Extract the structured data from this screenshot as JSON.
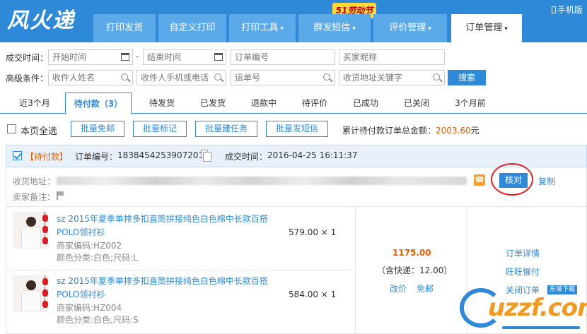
{
  "colors": {
    "brand": "#2e8ad8",
    "accent": "#e55c00",
    "highlight": "#e02020"
  },
  "header": {
    "logo": "风火递",
    "promo": "51劳动节",
    "mobile": "手机版",
    "nav": [
      {
        "label": "打印发货",
        "caret": ""
      },
      {
        "label": "自定义打印",
        "caret": ""
      },
      {
        "label": "打印工具",
        "caret": "▾"
      },
      {
        "label": "群发短信",
        "caret": "▾"
      },
      {
        "label": "评价管理",
        "caret": "▾"
      },
      {
        "label": "订单管理",
        "caret": "▾"
      }
    ]
  },
  "search": {
    "deal_time_label": "成交时间：",
    "advanced_label": "高级条件：",
    "start_time": "开始时间",
    "end_time": "结束时间",
    "order_no": "订单编号",
    "buyer_nick": "买家昵称",
    "receiver_name": "收件人姓名",
    "receiver_phone": "收件人手机或电话",
    "tracking_no": "运单号",
    "address_keyword": "收货地址关键字",
    "button": "搜索"
  },
  "status_tabs": [
    "近3个月",
    "待付款（3）",
    "待发货",
    "已发货",
    "退款中",
    "待评价",
    "已成功",
    "已关闭",
    "3个月前"
  ],
  "bulk": {
    "select_all": "本页全选",
    "buttons": [
      "批量免邮",
      "批量标记",
      "批量建任务",
      "批量发短信"
    ],
    "total_label": "累计待付款订单总金额：",
    "total_amount": "2003.60",
    "total_unit": "元"
  },
  "order": {
    "status_tag": "【待付款】",
    "order_no_label": "订单编号：",
    "order_no": "1838454253907201",
    "deal_time_label": "成交时间：",
    "deal_time": "2016-04-25 16:11:37",
    "address_label": "收货地址：",
    "memo_label": "卖家备注：",
    "verify": "核对",
    "copy": "复制",
    "items": [
      {
        "title": "sz 2015年夏季单排多扣直筒拼接纯色白色棉中长款百搭POLO领衬衫",
        "code": "商家编码:HZ002",
        "spec": "颜色分类:白色;尺码:L",
        "price": "579.00 × 1"
      },
      {
        "title": "sz 2015年夏季单排多扣直筒拼接纯色白色棉中长款百搭POLO领衬衫",
        "code": "商家编码:HZ004",
        "spec": "颜色分类:白色;尺码:S",
        "price": "584.00 × 1"
      }
    ],
    "payment": {
      "total": "1175.00",
      "shipping": "（含快递：12.00）",
      "edit_price": "改价",
      "free_shipping": "免邮"
    },
    "ops": [
      "订单详情",
      "旺旺催付",
      "关闭订单"
    ]
  },
  "watermark": {
    "text": "uzzf.com",
    "sub": "东坡下载"
  }
}
